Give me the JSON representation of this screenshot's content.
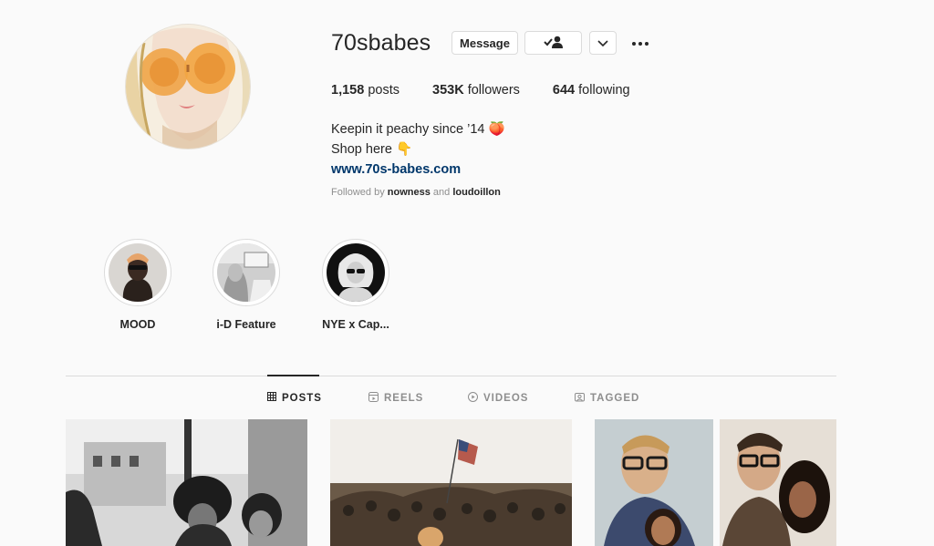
{
  "profile": {
    "username": "70sbabes",
    "message_label": "Message",
    "stats": [
      {
        "count": "1,158",
        "label": "posts"
      },
      {
        "count": "353K",
        "label": "followers"
      },
      {
        "count": "644",
        "label": "following"
      }
    ],
    "bio_line1": "Keepin it peachy since ’14 🍑",
    "bio_line2": "Shop here 👇",
    "link": "www.70s-babes.com",
    "followed_prefix": "Followed by",
    "followed_user1": "nowness",
    "followed_and": "and",
    "followed_user2": "loudoillon"
  },
  "highlights": [
    {
      "label": "MOOD"
    },
    {
      "label": "i-D Feature"
    },
    {
      "label": "NYE x Cap..."
    }
  ],
  "tabs": [
    {
      "label": "POSTS",
      "icon": "grid-icon",
      "active": true
    },
    {
      "label": "REELS",
      "icon": "reels-icon",
      "active": false
    },
    {
      "label": "VIDEOS",
      "icon": "play-icon",
      "active": false
    },
    {
      "label": "TAGGED",
      "icon": "tag-icon",
      "active": false
    }
  ],
  "colors": {
    "link": "#00376b",
    "text": "#262626",
    "muted": "#8e8e8e",
    "border": "#dbdbdb"
  }
}
